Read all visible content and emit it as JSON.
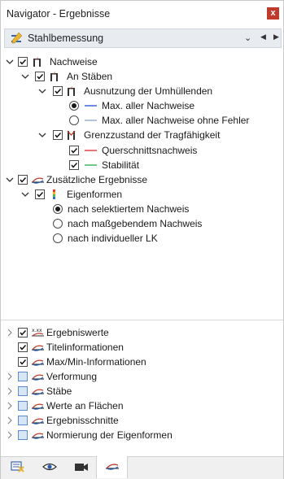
{
  "window": {
    "title": "Navigator - Ergebnisse",
    "close_label": "x"
  },
  "combo": {
    "label": "Stahlbemessung"
  },
  "tree": {
    "nachweise": "Nachweise",
    "an_staeben": "An Stäben",
    "ausnutzung": "Ausnutzung der Umhüllenden",
    "max_aller": "Max. aller Nachweise",
    "max_aller_ohne": "Max. aller Nachweise ohne Fehler",
    "grenzzustand": "Grenzzustand der Tragfähigkeit",
    "querschnitt": "Querschnittsnachweis",
    "stabilitaet": "Stabilität",
    "zusaetzliche": "Zusätzliche Ergebnisse",
    "eigenformen": "Eigenformen",
    "nach_selektiertem": "nach selektiertem Nachweis",
    "nach_massgebendem": "nach maßgebendem Nachweis",
    "nach_individueller": "nach individueller LK"
  },
  "bottom": {
    "ergebniswerte": "Ergebniswerte",
    "ergebniswerte_icon": "x.xx",
    "titelinformationen": "Titelinformationen",
    "maxmin": "Max/Min-Informationen",
    "verformung": "Verformung",
    "staebe": "Stäbe",
    "werte_flaechen": "Werte an Flächen",
    "ergebnisschnitte": "Ergebnisschnitte",
    "normierung": "Normierung der Eigenformen"
  },
  "colors": {
    "max_aller_line": "#1f4fd1",
    "max_aller_ohne_line": "#8aa6c8",
    "querschnitt_line": "#e0262b",
    "stabilitaet_line": "#2aa84a",
    "close_bg": "#c0392b"
  },
  "tabs": [
    "data-icon",
    "eye-icon",
    "camera-icon",
    "results-icon"
  ]
}
